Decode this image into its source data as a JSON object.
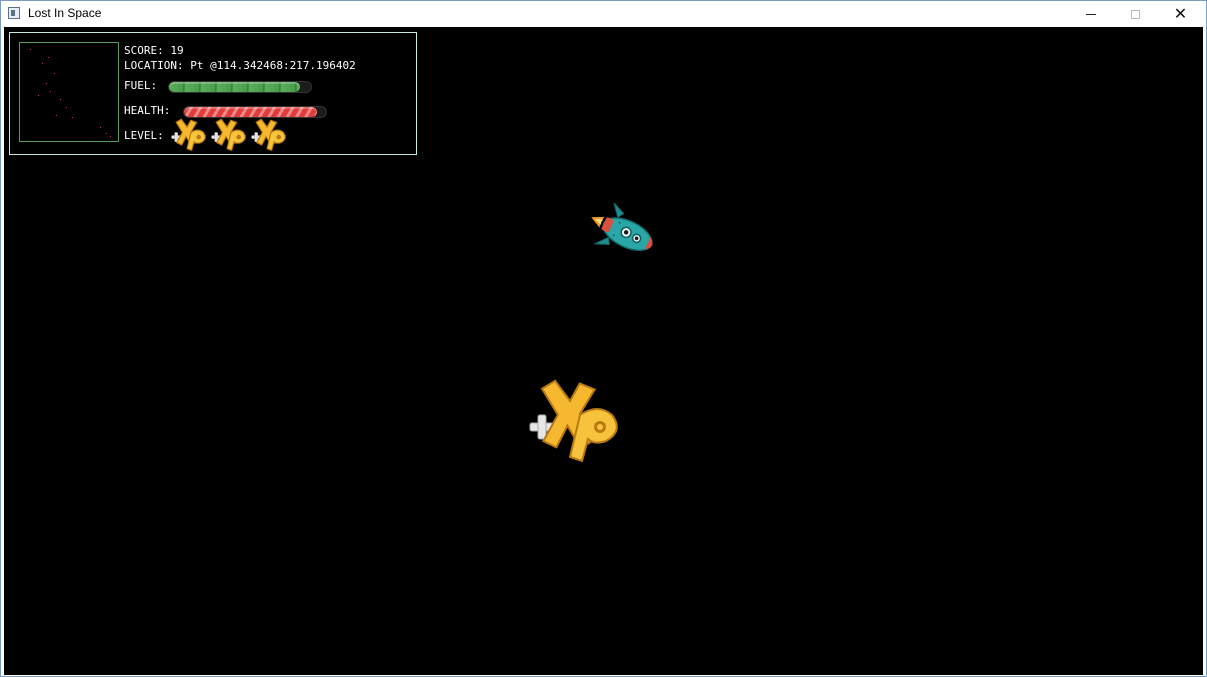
{
  "window": {
    "title": "Lost In Space",
    "controls": {
      "minimize": "minimize",
      "maximize": "maximize",
      "close": "✕"
    }
  },
  "hud": {
    "score_text": "SCORE: 19",
    "location_text": "LOCATION: Pt @114.342468:217.196402",
    "fuel_label": "FUEL:",
    "health_label": "HEALTH:",
    "level_label": "LEVEL:",
    "fuel_fraction": 0.92,
    "health_fraction": 0.94,
    "level_icon_count": 3,
    "level_icon": "xp-plus-icon"
  },
  "scene": {
    "player": "rocket-ship",
    "pickup": "xp-plus-pickup"
  },
  "colors": {
    "background": "#000000",
    "hud_border": "#c9e9e4",
    "minimap_border": "#5c9a5c",
    "fuel": "#58b05a",
    "health": "#e23b3b",
    "xp_gold": "#f5b82e",
    "rocket_teal": "#2aa6a6"
  }
}
